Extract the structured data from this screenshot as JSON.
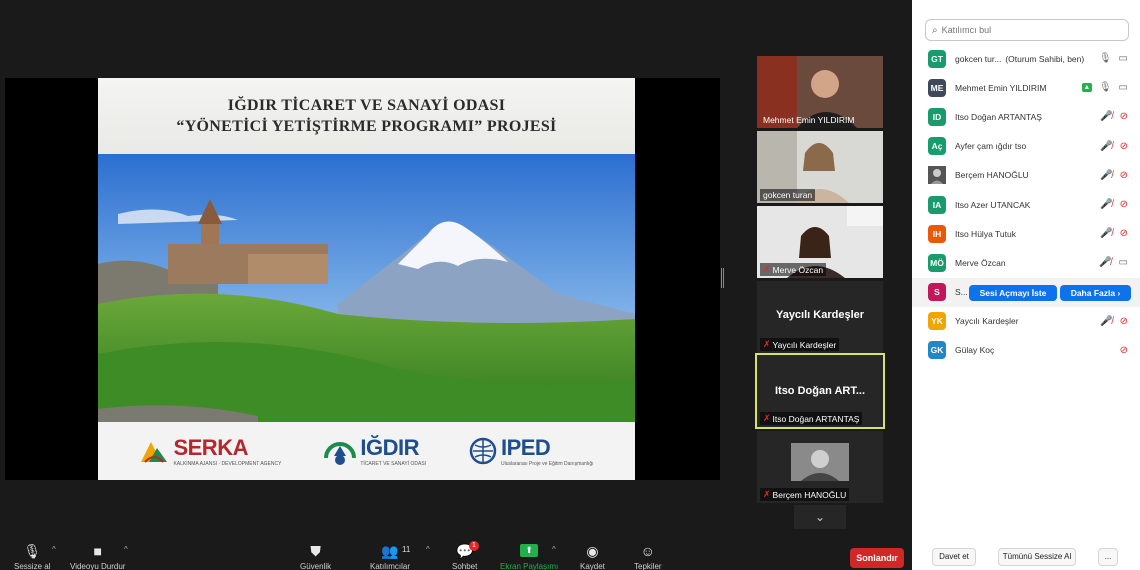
{
  "slide": {
    "title_line1": "IĞDIR TİCARET VE SANAYİ ODASI",
    "title_line2": "“YÖNETİCİ YETİŞTİRME PROGRAMI” PROJESİ",
    "logos": [
      {
        "text": "SERKA",
        "sub": "KALKINMA AJANSI · DEVELOPMENT AGENCY",
        "color": "#b5272f"
      },
      {
        "text": "IĞDIR",
        "sub": "TİCARET VE SANAYİ ODASI",
        "color": "#1f4e8c"
      },
      {
        "text": "IPED",
        "sub": "Uluslararası Proje ve Eğitim Danışmanlığı",
        "color": "#1f4e8c"
      }
    ]
  },
  "tiles": [
    {
      "name": "Mehmet Emin YILDIRIM",
      "muted": false,
      "video": true
    },
    {
      "name": "gokcen turan",
      "muted": false,
      "video": true
    },
    {
      "name": "Merve Özcan",
      "muted": true,
      "video": true
    },
    {
      "name": "Yaycılı Kardeşler",
      "center": "Yaycılı Kardeşler",
      "muted": true,
      "video": false
    },
    {
      "name": "Itso Doğan ARTANTAŞ",
      "center": "Itso Doğan ART...",
      "muted": true,
      "video": false,
      "active": true
    },
    {
      "name": "Berçem HANOĞLU",
      "muted": true,
      "video": true
    }
  ],
  "toolbar": {
    "mute": "Sessize al",
    "video": "Videoyu Durdur",
    "security": "Güvenlik",
    "participants": "Katılımcılar",
    "participants_count": "11",
    "chat": "Sohbet",
    "chat_badge": "1",
    "share": "Ekran Paylaşımı",
    "record": "Kaydet",
    "reactions": "Tepkiler",
    "end": "Sonlandır"
  },
  "panel": {
    "search_placeholder": "Katılımcı bul",
    "participants": [
      {
        "initials": "GT",
        "color": "#1a9b6c",
        "name": "gokcen tur...",
        "role": "(Oturum Sahibi, ben)",
        "mic": "on",
        "video": "on"
      },
      {
        "initials": "ME",
        "color": "#3e4a5a",
        "name": "Mehmet Emin YILDIRIM",
        "role": "",
        "mic": "on",
        "video": "on",
        "sharing": true
      },
      {
        "initials": "ID",
        "color": "#1a9b6c",
        "name": "Itso Doğan ARTANTAŞ",
        "role": "",
        "mic": "off",
        "video": "off"
      },
      {
        "initials": "Aç",
        "color": "#1a9b6c",
        "name": "Ayfer çam ığdır tso",
        "role": "",
        "mic": "off",
        "video": "off"
      },
      {
        "initials": "",
        "color": "#333333",
        "name": "Berçem HANOĞLU",
        "role": "",
        "mic": "off",
        "video": "off",
        "photo": true
      },
      {
        "initials": "IA",
        "color": "#1a9b6c",
        "name": "Itso Azer UTANCAK",
        "role": "",
        "mic": "off",
        "video": "off"
      },
      {
        "initials": "IH",
        "color": "#e8590c",
        "name": "Itso Hülya Tutuk",
        "role": "",
        "mic": "off",
        "video": "off"
      },
      {
        "initials": "MÖ",
        "color": "#1a9b6c",
        "name": "Merve Özcan",
        "role": "",
        "mic": "off",
        "video": "on"
      },
      {
        "initials": "S",
        "color": "#c2185b",
        "name": "S...",
        "role": "",
        "hover": true
      },
      {
        "initials": "YK",
        "color": "#f0a500",
        "name": "Yaycılı Kardeşler",
        "role": "",
        "mic": "off",
        "video": "off"
      },
      {
        "initials": "GK",
        "color": "#1e88c8",
        "name": "Gülay Koç",
        "role": "",
        "mic": "none",
        "video": "off"
      }
    ],
    "ask_unmute": "Sesi Açmayı İste",
    "more": "Daha Fazla",
    "invite": "Davet et",
    "mute_all": "Tümünü Sessize Al",
    "ellipsis": "..."
  }
}
